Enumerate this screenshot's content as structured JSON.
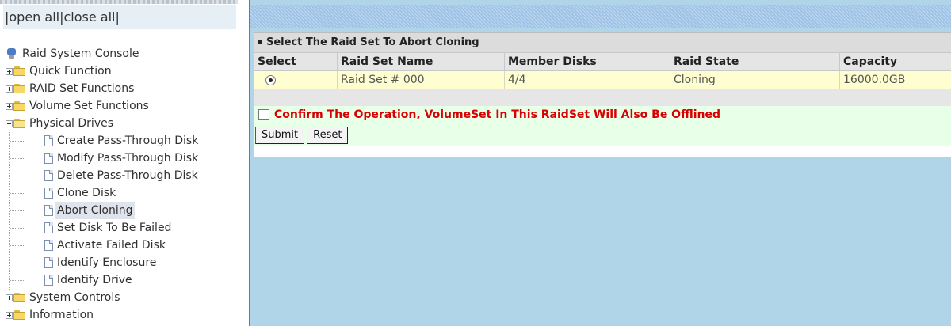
{
  "tree_header": {
    "open_all": "open all",
    "close_all": "close all",
    "sep_left": "|",
    "sep_mid": "|",
    "sep_right": "|"
  },
  "tree": {
    "root_label": "Raid System Console",
    "items": [
      {
        "label": "Quick Function"
      },
      {
        "label": "RAID Set Functions"
      },
      {
        "label": "Volume Set Functions"
      },
      {
        "label": "Physical Drives"
      }
    ],
    "children": [
      {
        "label": "Create Pass-Through Disk"
      },
      {
        "label": "Modify Pass-Through Disk"
      },
      {
        "label": "Delete Pass-Through Disk"
      },
      {
        "label": "Clone Disk"
      },
      {
        "label": "Abort Cloning"
      },
      {
        "label": "Set Disk To Be Failed"
      },
      {
        "label": "Activate Failed Disk"
      },
      {
        "label": "Identify Enclosure"
      },
      {
        "label": "Identify Drive"
      }
    ],
    "after": [
      {
        "label": "System Controls"
      },
      {
        "label": "Information"
      }
    ]
  },
  "panel": {
    "title": "Select The Raid Set To Abort Cloning",
    "columns": [
      "Select",
      "Raid Set Name",
      "Member Disks",
      "Raid State",
      "Capacity"
    ],
    "rows": [
      {
        "name": "Raid Set # 000",
        "members": "4/4",
        "state": "Cloning",
        "capacity": "16000.0GB"
      }
    ],
    "confirm_text": "Confirm The Operation, VolumeSet In This RaidSet Will Also Be Offlined",
    "submit_label": "Submit",
    "reset_label": "Reset"
  }
}
